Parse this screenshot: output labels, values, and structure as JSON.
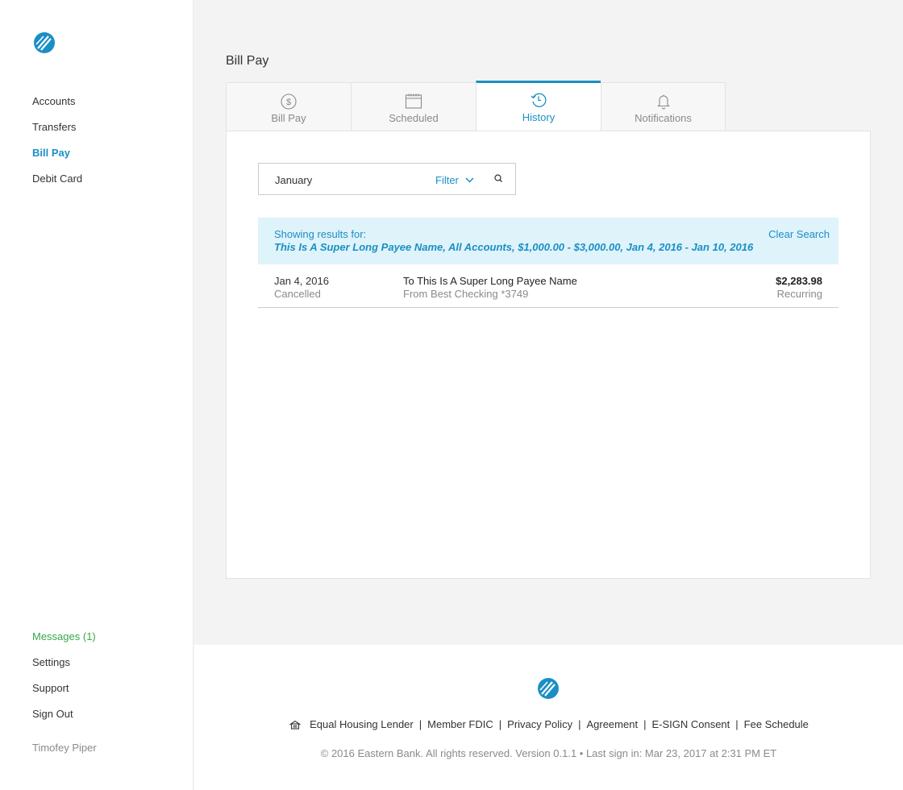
{
  "brand": {
    "accent": "#1a8fc4",
    "messages_color": "#3aa84a"
  },
  "sidebar": {
    "logo_icon": "bank-logo-icon",
    "nav": [
      {
        "label": "Accounts"
      },
      {
        "label": "Transfers"
      },
      {
        "label": "Bill Pay",
        "active": true
      },
      {
        "label": "Debit Card"
      }
    ],
    "bottom": [
      {
        "label": "Messages (1)"
      },
      {
        "label": "Settings"
      },
      {
        "label": "Support"
      },
      {
        "label": "Sign Out"
      }
    ],
    "user_name": "Timofey Piper"
  },
  "main": {
    "title": "Bill Pay",
    "tabs": [
      {
        "label": "Bill Pay",
        "icon": "dollar-circle-icon"
      },
      {
        "label": "Scheduled",
        "icon": "calendar-icon"
      },
      {
        "label": "History",
        "icon": "history-icon",
        "active": true
      },
      {
        "label": "Notifications",
        "icon": "bell-icon"
      }
    ],
    "search": {
      "value": "January",
      "filter_label": "Filter"
    },
    "results": {
      "label": "Showing results for:",
      "query": "This Is A Super Long Payee Name, All Accounts, $1,000.00 - $3,000.00, Jan 4, 2016 - Jan 10, 2016",
      "clear_label": "Clear Search"
    },
    "history": [
      {
        "date": "Jan 4, 2016",
        "status": "Cancelled",
        "payee": "To This Is A Super Long Payee Name",
        "from": "From Best Checking *3749",
        "amount": "$2,283.98",
        "frequency": "Recurring"
      }
    ]
  },
  "footer": {
    "links": [
      "Equal Housing Lender",
      "Member FDIC",
      "Privacy Policy",
      "Agreement",
      "E-SIGN Consent",
      "Fee Schedule"
    ],
    "copyright": "© 2016 Eastern Bank. All rights reserved. Version 0.1.1 • Last sign in: Mar 23, 2017 at 2:31 PM ET"
  }
}
